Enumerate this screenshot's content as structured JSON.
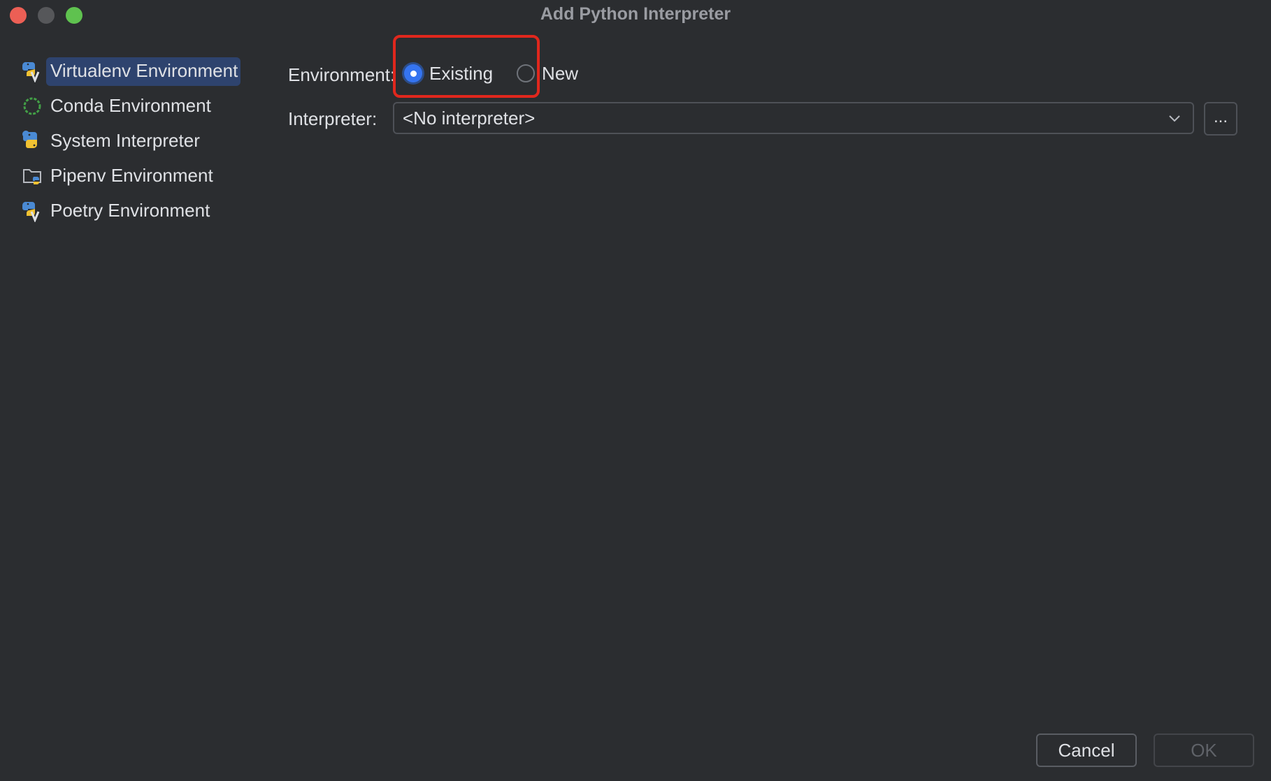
{
  "window": {
    "title": "Add Python Interpreter"
  },
  "sidebar": {
    "items": [
      {
        "label": "Virtualenv Environment",
        "icon": "virtualenv-icon",
        "selected": true
      },
      {
        "label": "Conda Environment",
        "icon": "conda-icon",
        "selected": false
      },
      {
        "label": "System Interpreter",
        "icon": "python-icon",
        "selected": false
      },
      {
        "label": "Pipenv Environment",
        "icon": "pipenv-folder-icon",
        "selected": false
      },
      {
        "label": "Poetry Environment",
        "icon": "poetry-icon",
        "selected": false
      }
    ]
  },
  "form": {
    "environment_label": "Environment:",
    "options": [
      {
        "label": "Existing",
        "checked": true
      },
      {
        "label": "New",
        "checked": false
      }
    ],
    "interpreter_label": "Interpreter:",
    "interpreter_value": "<No interpreter>",
    "browse_label": "..."
  },
  "footer": {
    "cancel_label": "Cancel",
    "ok_label": "OK"
  },
  "colors": {
    "background": "#2b2d30",
    "selection": "#2e436e",
    "accent": "#3574f0",
    "highlight": "#e0271d"
  }
}
